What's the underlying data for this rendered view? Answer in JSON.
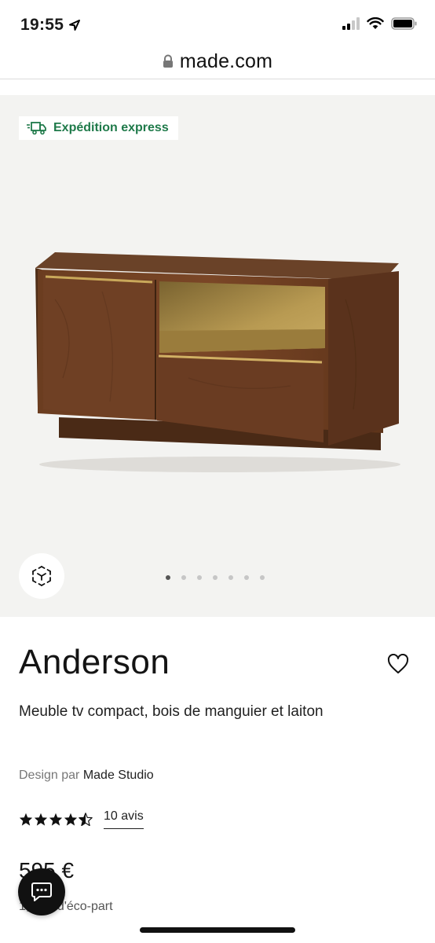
{
  "status_bar": {
    "time": "19:55"
  },
  "browser": {
    "url": "made.com"
  },
  "gallery": {
    "badge_text": "Expédition express",
    "image_count": 7,
    "active_index": 0
  },
  "product": {
    "name": "Anderson",
    "description": "Meuble tv compact, bois de manguier et laiton",
    "designer_prefix": "Design par",
    "designer_name": "Made Studio",
    "rating": 4.5,
    "reviews_label": "10 avis",
    "price": "595 €",
    "eco_part": "1,00 € d'éco-part"
  },
  "colors": {
    "accent_green": "#1f7a4a",
    "gallery_bg": "#f3f3f1",
    "text": "#141414"
  },
  "icons": {
    "location": "location-arrow-icon",
    "lock": "lock-icon",
    "badge": "delivery-truck-icon",
    "ar": "ar-cube-icon",
    "favorite": "heart-icon",
    "chat": "chat-bubble-icon"
  }
}
